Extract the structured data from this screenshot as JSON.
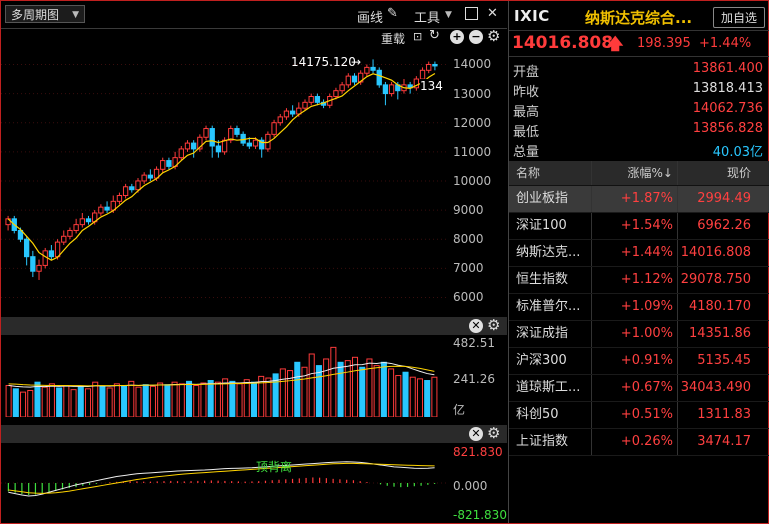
{
  "toolbar": {
    "period_label": "多周期图",
    "draw_label": "画线",
    "tools_label": "工具"
  },
  "kline": {
    "overlay_label": "重载",
    "y_ticks": [
      "14000",
      "13000",
      "12000",
      "11000",
      "10000",
      "9000",
      "8000",
      "7000",
      "6000"
    ],
    "high_marker": "14175.120",
    "last_label": "134",
    "candles": [
      [
        8500,
        8700,
        8300,
        8800
      ],
      [
        8700,
        8300,
        8200,
        8800
      ],
      [
        8300,
        8000,
        7900,
        8400
      ],
      [
        8000,
        7400,
        7100,
        8100
      ],
      [
        7400,
        6900,
        6700,
        7600
      ],
      [
        6900,
        7100,
        6600,
        7300
      ],
      [
        7100,
        7600,
        7000,
        7700
      ],
      [
        7600,
        7400,
        7300,
        7800
      ],
      [
        7400,
        7900,
        7300,
        8000
      ],
      [
        7900,
        8100,
        7800,
        8300
      ],
      [
        8100,
        8300,
        8000,
        8400
      ],
      [
        8300,
        8500,
        8200,
        8700
      ],
      [
        8500,
        8700,
        8400,
        8900
      ],
      [
        8700,
        8600,
        8500,
        8800
      ],
      [
        8600,
        8900,
        8500,
        9000
      ],
      [
        8900,
        9100,
        8800,
        9200
      ],
      [
        9100,
        9000,
        8900,
        9300
      ],
      [
        9000,
        9300,
        8900,
        9500
      ],
      [
        9300,
        9500,
        9200,
        9600
      ],
      [
        9500,
        9800,
        9400,
        9900
      ],
      [
        9800,
        9700,
        9600,
        9900
      ],
      [
        9700,
        10000,
        9600,
        10100
      ],
      [
        10000,
        10200,
        9900,
        10300
      ],
      [
        10200,
        10100,
        10000,
        10400
      ],
      [
        10100,
        10400,
        10000,
        10500
      ],
      [
        10400,
        10700,
        10300,
        10800
      ],
      [
        10700,
        10500,
        10400,
        10800
      ],
      [
        10500,
        10800,
        10400,
        11000
      ],
      [
        10800,
        11100,
        10700,
        11200
      ],
      [
        11100,
        11300,
        11000,
        11400
      ],
      [
        11300,
        11100,
        10800,
        11400
      ],
      [
        11100,
        11500,
        11000,
        11600
      ],
      [
        11500,
        11800,
        11400,
        11900
      ],
      [
        11800,
        11200,
        10800,
        11900
      ],
      [
        11200,
        11000,
        10800,
        11400
      ],
      [
        11000,
        11400,
        10900,
        11500
      ],
      [
        11400,
        11800,
        11300,
        11900
      ],
      [
        11800,
        11600,
        11500,
        11900
      ],
      [
        11600,
        11300,
        11200,
        11700
      ],
      [
        11300,
        11200,
        11100,
        11500
      ],
      [
        11200,
        11400,
        11100,
        11500
      ],
      [
        11400,
        11100,
        10800,
        11500
      ],
      [
        11100,
        11600,
        11000,
        11700
      ],
      [
        11600,
        12000,
        11500,
        12100
      ],
      [
        12000,
        12200,
        11900,
        12300
      ],
      [
        12200,
        12400,
        12100,
        12500
      ],
      [
        12400,
        12300,
        12200,
        12600
      ],
      [
        12300,
        12500,
        12200,
        12700
      ],
      [
        12500,
        12700,
        12400,
        12800
      ],
      [
        12700,
        12900,
        12600,
        13000
      ],
      [
        12900,
        12700,
        12600,
        13000
      ],
      [
        12700,
        12600,
        12500,
        12800
      ],
      [
        12600,
        12900,
        12500,
        13000
      ],
      [
        12900,
        13100,
        12800,
        13200
      ],
      [
        13100,
        13300,
        13000,
        13400
      ],
      [
        13300,
        13600,
        13200,
        13700
      ],
      [
        13600,
        13400,
        13300,
        13700
      ],
      [
        13400,
        13700,
        13300,
        13800
      ],
      [
        13700,
        13900,
        13600,
        14000
      ],
      [
        13900,
        13800,
        13700,
        14175
      ],
      [
        13800,
        13300,
        13200,
        13900
      ],
      [
        13300,
        13000,
        12600,
        13400
      ],
      [
        13000,
        13300,
        12900,
        13400
      ],
      [
        13300,
        13100,
        12800,
        13400
      ],
      [
        13100,
        13300,
        13000,
        13500
      ],
      [
        13300,
        13200,
        13000,
        13400
      ],
      [
        13200,
        13500,
        13100,
        13600
      ],
      [
        13500,
        13800,
        13400,
        13900
      ],
      [
        13800,
        14000,
        13700,
        14100
      ],
      [
        14000,
        13950,
        13800,
        14100
      ]
    ]
  },
  "volume": {
    "ticks": [
      "482.51",
      "241.26",
      "亿"
    ],
    "bars": [
      190,
      170,
      150,
      160,
      210,
      180,
      200,
      175,
      190,
      165,
      185,
      170,
      210,
      185,
      175,
      200,
      190,
      215,
      180,
      195,
      185,
      205,
      195,
      210,
      200,
      215,
      190,
      205,
      220,
      210,
      230,
      215,
      200,
      225,
      210,
      245,
      235,
      260,
      290,
      280,
      330,
      300,
      380,
      310,
      350,
      420,
      330,
      340,
      360,
      300,
      350,
      310,
      330,
      290,
      250,
      270,
      240,
      230,
      220,
      240
    ],
    "ma1": [
      190,
      185,
      182,
      180,
      185,
      183,
      186,
      185,
      187,
      185,
      185,
      184,
      188,
      188,
      186,
      189,
      189,
      192,
      190,
      192,
      191,
      194,
      194,
      196,
      196,
      198,
      197,
      199,
      201,
      202,
      205,
      205,
      205,
      208,
      208,
      213,
      215,
      220,
      228,
      233,
      242,
      248,
      262,
      268,
      280,
      294,
      300,
      306,
      315,
      316,
      325,
      323,
      329,
      323,
      312,
      305,
      290,
      275,
      262,
      255
    ],
    "ma2": [
      200,
      198,
      195,
      193,
      192,
      191,
      190,
      190,
      190,
      189,
      189,
      188,
      189,
      189,
      189,
      190,
      190,
      191,
      191,
      192,
      192,
      193,
      193,
      194,
      195,
      196,
      196,
      197,
      198,
      199,
      200,
      201,
      202,
      203,
      204,
      206,
      208,
      211,
      215,
      219,
      224,
      229,
      236,
      242,
      249,
      257,
      264,
      271,
      279,
      285,
      292,
      297,
      302,
      305,
      306,
      305,
      300,
      293,
      284,
      275
    ],
    "ymax": 482.51
  },
  "macd": {
    "ticks": [
      "821.830",
      "0.000",
      "-821.830"
    ],
    "annotation": "顶背离",
    "hist": [
      -180,
      -210,
      -240,
      -260,
      -250,
      -220,
      -200,
      -170,
      -140,
      -110,
      -90,
      -60,
      -40,
      -20,
      0,
      15,
      25,
      35,
      40,
      35,
      30,
      30,
      35,
      40,
      45,
      40,
      35,
      40,
      45,
      50,
      55,
      50,
      45,
      40,
      35,
      30,
      35,
      40,
      50,
      60,
      70,
      80,
      90,
      100,
      110,
      120,
      115,
      105,
      90,
      80,
      70,
      60,
      40,
      20,
      0,
      -30,
      -60,
      -80,
      -90,
      -85,
      -70,
      -60,
      -40,
      -20
    ],
    "dif": [
      -200,
      -230,
      -260,
      -280,
      -270,
      -240,
      -200,
      -160,
      -120,
      -80,
      -40,
      -10,
      20,
      50,
      80,
      110,
      140,
      160,
      180,
      200,
      210,
      220,
      230,
      240,
      250,
      260,
      265,
      270,
      275,
      280,
      290,
      300,
      310,
      315,
      320,
      325,
      330,
      340,
      350,
      360,
      370,
      380,
      390,
      400,
      410,
      420,
      430,
      440,
      450,
      455,
      460,
      455,
      445,
      430,
      410,
      390,
      370,
      350,
      340,
      330,
      320,
      315,
      320,
      330
    ],
    "dea": [
      -150,
      -170,
      -190,
      -210,
      -220,
      -225,
      -220,
      -210,
      -195,
      -175,
      -150,
      -125,
      -100,
      -75,
      -50,
      -25,
      0,
      25,
      50,
      75,
      95,
      115,
      135,
      150,
      165,
      180,
      195,
      205,
      215,
      225,
      235,
      245,
      255,
      265,
      275,
      285,
      295,
      305,
      315,
      325,
      335,
      345,
      355,
      365,
      375,
      385,
      395,
      405,
      415,
      420,
      425,
      425,
      420,
      415,
      410,
      405,
      400,
      395,
      390,
      385,
      380,
      375,
      372,
      370
    ],
    "ymax": 821.83
  },
  "quote": {
    "code": "IXIC",
    "name": "纳斯达克综合...",
    "add_label": "加自选",
    "price": "14016.808",
    "change": "198.395",
    "percent": "+1.44%",
    "arrow": "🡅"
  },
  "stats": [
    {
      "label": "开盘",
      "value": "13861.400",
      "color": "#ff4040"
    },
    {
      "label": "昨收",
      "value": "13818.413",
      "color": "#dddddd"
    },
    {
      "label": "最高",
      "value": "14062.736",
      "color": "#ff4040"
    },
    {
      "label": "最低",
      "value": "13856.828",
      "color": "#ff4040"
    },
    {
      "label": "总量",
      "value": "40.03亿",
      "color": "#29c7ff"
    }
  ],
  "table": {
    "headers": [
      "名称",
      "涨幅%↓",
      "现价"
    ],
    "rows": [
      {
        "name": "创业板指",
        "pct": "+1.87%",
        "price": "2994.49"
      },
      {
        "name": "深证100",
        "pct": "+1.54%",
        "price": "6962.26"
      },
      {
        "name": "纳斯达克...",
        "pct": "+1.44%",
        "price": "14016.808"
      },
      {
        "name": "恒生指数",
        "pct": "+1.12%",
        "price": "29078.750"
      },
      {
        "name": "标准普尔...",
        "pct": "+1.09%",
        "price": "4180.170"
      },
      {
        "name": "深证成指",
        "pct": "+1.00%",
        "price": "14351.86"
      },
      {
        "name": "沪深300",
        "pct": "+0.91%",
        "price": "5135.45"
      },
      {
        "name": "道琼斯工...",
        "pct": "+0.67%",
        "price": "34043.490"
      },
      {
        "name": "科创50",
        "pct": "+0.51%",
        "price": "1311.83"
      },
      {
        "name": "上证指数",
        "pct": "+0.26%",
        "price": "3474.17"
      }
    ]
  },
  "colors": {
    "up": "#ff3b3b",
    "down": "#29c7ff",
    "ma_yellow": "#ffd400",
    "ma_white": "#eeeeee",
    "border": "#c0201f"
  }
}
